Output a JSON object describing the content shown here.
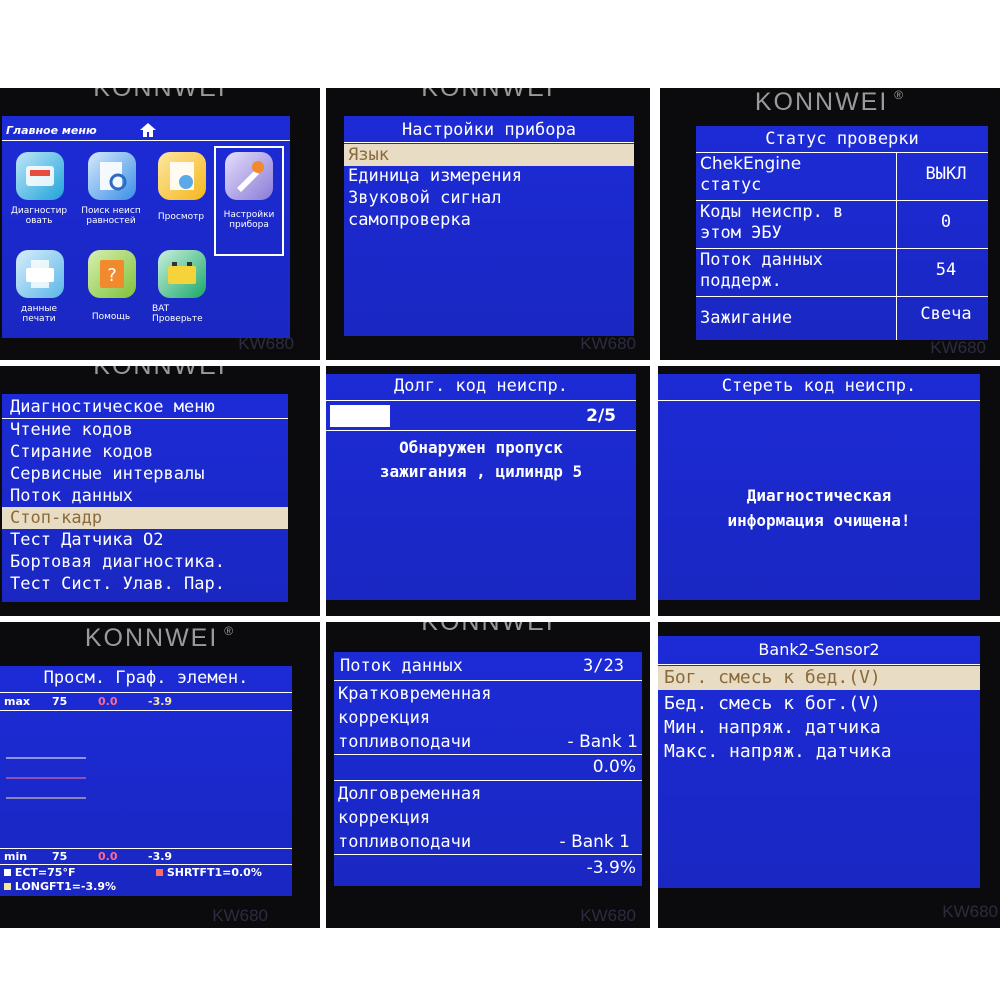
{
  "brand": "KONNWEI",
  "model": "KW680",
  "panel1": {
    "title": "Главное меню",
    "items": [
      {
        "label": "Диагностир\nовать",
        "icon": "diagnose-icon",
        "color": "#1fa3d9"
      },
      {
        "label": "Поиск неисп\nравностей",
        "icon": "search-dtc-icon",
        "color": "#3b8ee6"
      },
      {
        "label": "Просмотр",
        "icon": "review-icon",
        "color": "#f5b71c"
      },
      {
        "label": "Настройки\nприбора",
        "icon": "settings-icon",
        "color": "#8a7bd8"
      },
      {
        "label": "данные\nпечати",
        "icon": "print-icon",
        "color": "#5ab6e8"
      },
      {
        "label": "Помощь",
        "icon": "help-icon",
        "color": "#7ec13a"
      },
      {
        "label": "BAT\nПроверьте",
        "icon": "battery-icon",
        "color": "#1aa86a"
      }
    ]
  },
  "panel2": {
    "title": "Настройки прибора",
    "items": [
      "Язык",
      "Единица измерения",
      "Звуковой сигнал",
      "самопроверка"
    ],
    "selected_index": 0
  },
  "panel3": {
    "title": "Статус проверки",
    "rows": [
      {
        "label1": "ChekEngine",
        "label2": "статус",
        "value": "ВЫКЛ"
      },
      {
        "label1": "Коды неиспр. в",
        "label2": "этом ЭБУ",
        "value": "0"
      },
      {
        "label1": "Поток данных",
        "label2": "поддерж.",
        "value": "54"
      },
      {
        "label1": "Зажигание",
        "label2": "",
        "value": "Свеча"
      }
    ]
  },
  "panel4": {
    "title": "Диагностическое меню",
    "items": [
      "Чтение кодов",
      "Стирание кодов",
      "Сервисные интервалы",
      "Поток данных",
      "Стоп-кадр",
      "Тест Датчика O2",
      "Бортовая диагностика.",
      "Тест Сист. Улав. Пар."
    ],
    "selected_index": 4
  },
  "panel5": {
    "title": "Долг. код неиспр.",
    "counter": "2/5",
    "progress_fraction": 0.4,
    "message_line1": "Обнаружен пропуск",
    "message_line2": "зажигания , цилиндр 5"
  },
  "panel6": {
    "title": "Стереть код неиспр.",
    "message_line1": "Диагностическая",
    "message_line2": "информация очищена!"
  },
  "panel7": {
    "title": "Просм. Граф. элемен.",
    "max_label": "max",
    "max_values": [
      "75",
      "0.0",
      "-3.9"
    ],
    "min_label": "min",
    "min_values": [
      "75",
      "0.0",
      "-3.9"
    ],
    "legend": [
      {
        "text": "ECT=75°F",
        "color": "#ffffff"
      },
      {
        "text": "SHRTFT1=0.0%",
        "color": "#ff6b6b"
      },
      {
        "text": "LONGFT1=-3.9%",
        "color": "#f5e6a0"
      }
    ],
    "series_colors": [
      "#ffffff",
      "#ff7b9c",
      "#f5e6a0"
    ]
  },
  "panel8": {
    "title": "Поток данных",
    "counter": "3/23",
    "items": [
      {
        "line1": "Кратковременная",
        "line2": "коррекция",
        "line3": "топливоподачи",
        "bank": "- Bank 1",
        "value": "0.0%"
      },
      {
        "line1": "Долговременная",
        "line2": "коррекция",
        "line3": "топливоподачи",
        "bank": "- Bank 1",
        "value": "-3.9%"
      }
    ]
  },
  "panel9": {
    "title": "Bank2-Sensor2",
    "items": [
      "Бог. смесь к бед.(V)",
      "Бед. смесь к бог.(V)",
      "Мин. напряж. датчика",
      "Макс. напряж. датчика"
    ],
    "selected_index": 0
  }
}
